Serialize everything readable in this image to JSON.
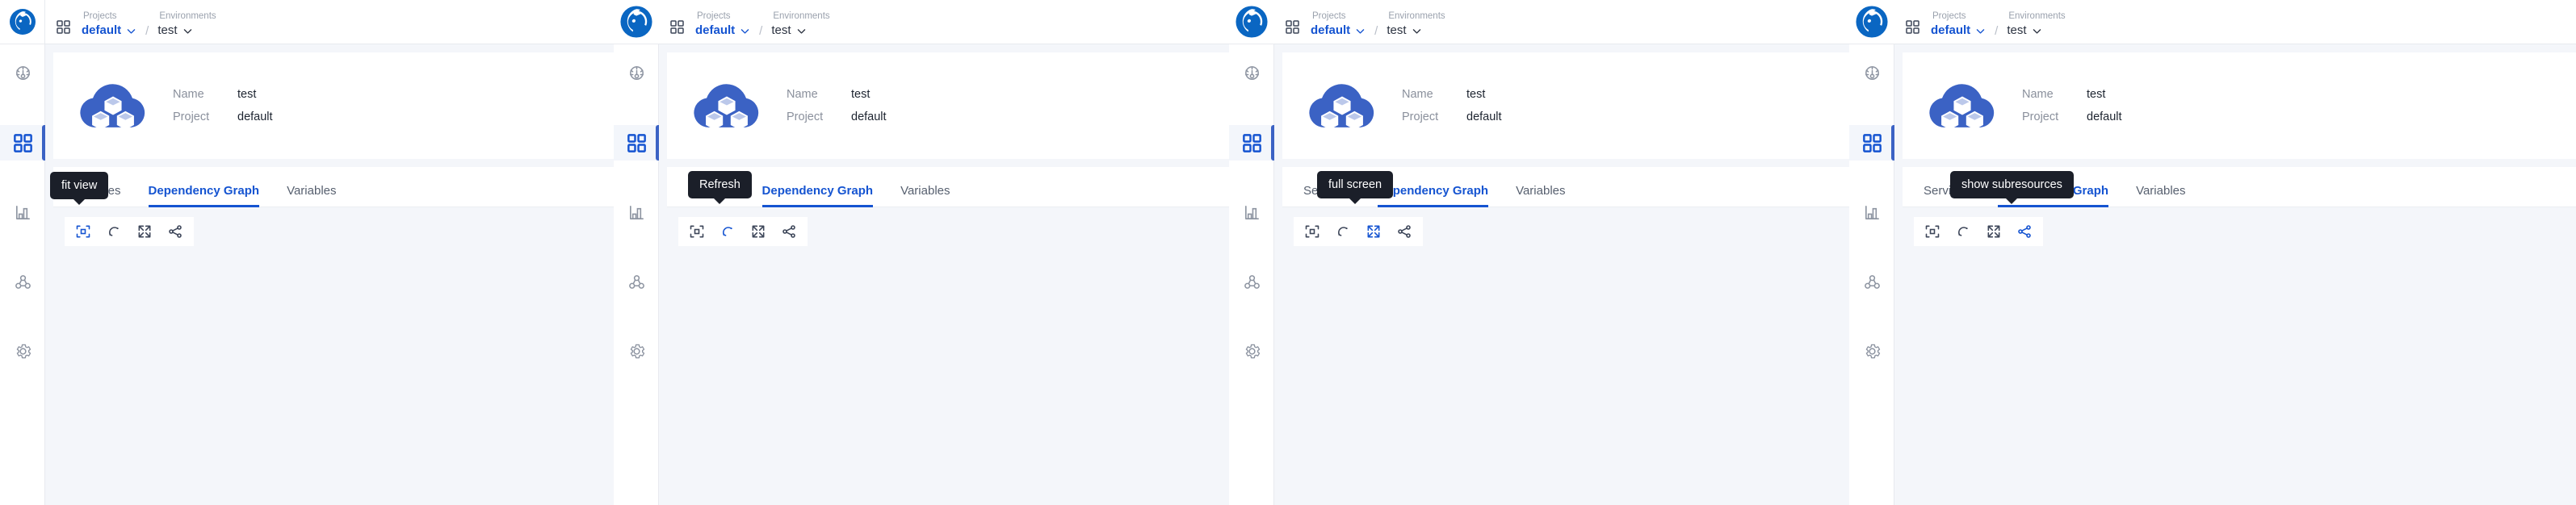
{
  "app": {
    "logo_icon": "cat-logo-icon"
  },
  "header": {
    "apps_icon": "grid-apps-icon",
    "projects": {
      "label": "Projects",
      "value": "default",
      "chevron_icon": "chevron-down-icon"
    },
    "separator": "/",
    "environments": {
      "label": "Environments",
      "value": "test",
      "chevron_icon": "chevron-down-icon"
    }
  },
  "sidebar": {
    "items": [
      {
        "name": "dashboard",
        "icon": "gauge-icon",
        "active": false
      },
      {
        "name": "resources",
        "icon": "grid-apps-icon",
        "active": true
      },
      {
        "name": "metrics",
        "icon": "bar-chart-icon",
        "active": false
      },
      {
        "name": "topology",
        "icon": "nodes-icon",
        "active": false
      },
      {
        "name": "settings",
        "icon": "gear-icon",
        "active": false
      }
    ]
  },
  "info_card": {
    "icon": "cloud-cubes-icon",
    "rows": [
      {
        "key": "Name",
        "value": "test"
      },
      {
        "key": "Project",
        "value": "default"
      }
    ]
  },
  "tabs": [
    {
      "label": "Services",
      "active": false
    },
    {
      "label": "Dependency Graph",
      "active": true
    },
    {
      "label": "Variables",
      "active": false
    }
  ],
  "graph_toolbar": {
    "buttons": [
      {
        "label": "fit view",
        "icon": "fit-view-icon"
      },
      {
        "label": "Refresh",
        "icon": "refresh-icon"
      },
      {
        "label": "full screen",
        "icon": "full-screen-icon"
      },
      {
        "label": "show subresources",
        "icon": "share-nodes-icon"
      }
    ]
  },
  "panels": [
    {
      "id": "panel-1",
      "tooltip": "fit view",
      "active_button_index": 0
    },
    {
      "id": "panel-2",
      "tooltip": "Refresh",
      "active_button_index": 1
    },
    {
      "id": "panel-3",
      "tooltip": "full screen",
      "active_button_index": 2
    },
    {
      "id": "panel-4",
      "tooltip": "show subresources",
      "active_button_index": 3
    }
  ],
  "colors": {
    "accent": "#1554d1",
    "cloud": "#3b62c4",
    "tooltip_bg": "#1b1f29",
    "bg": "#f4f6fa",
    "muted_text": "#8a909c"
  }
}
